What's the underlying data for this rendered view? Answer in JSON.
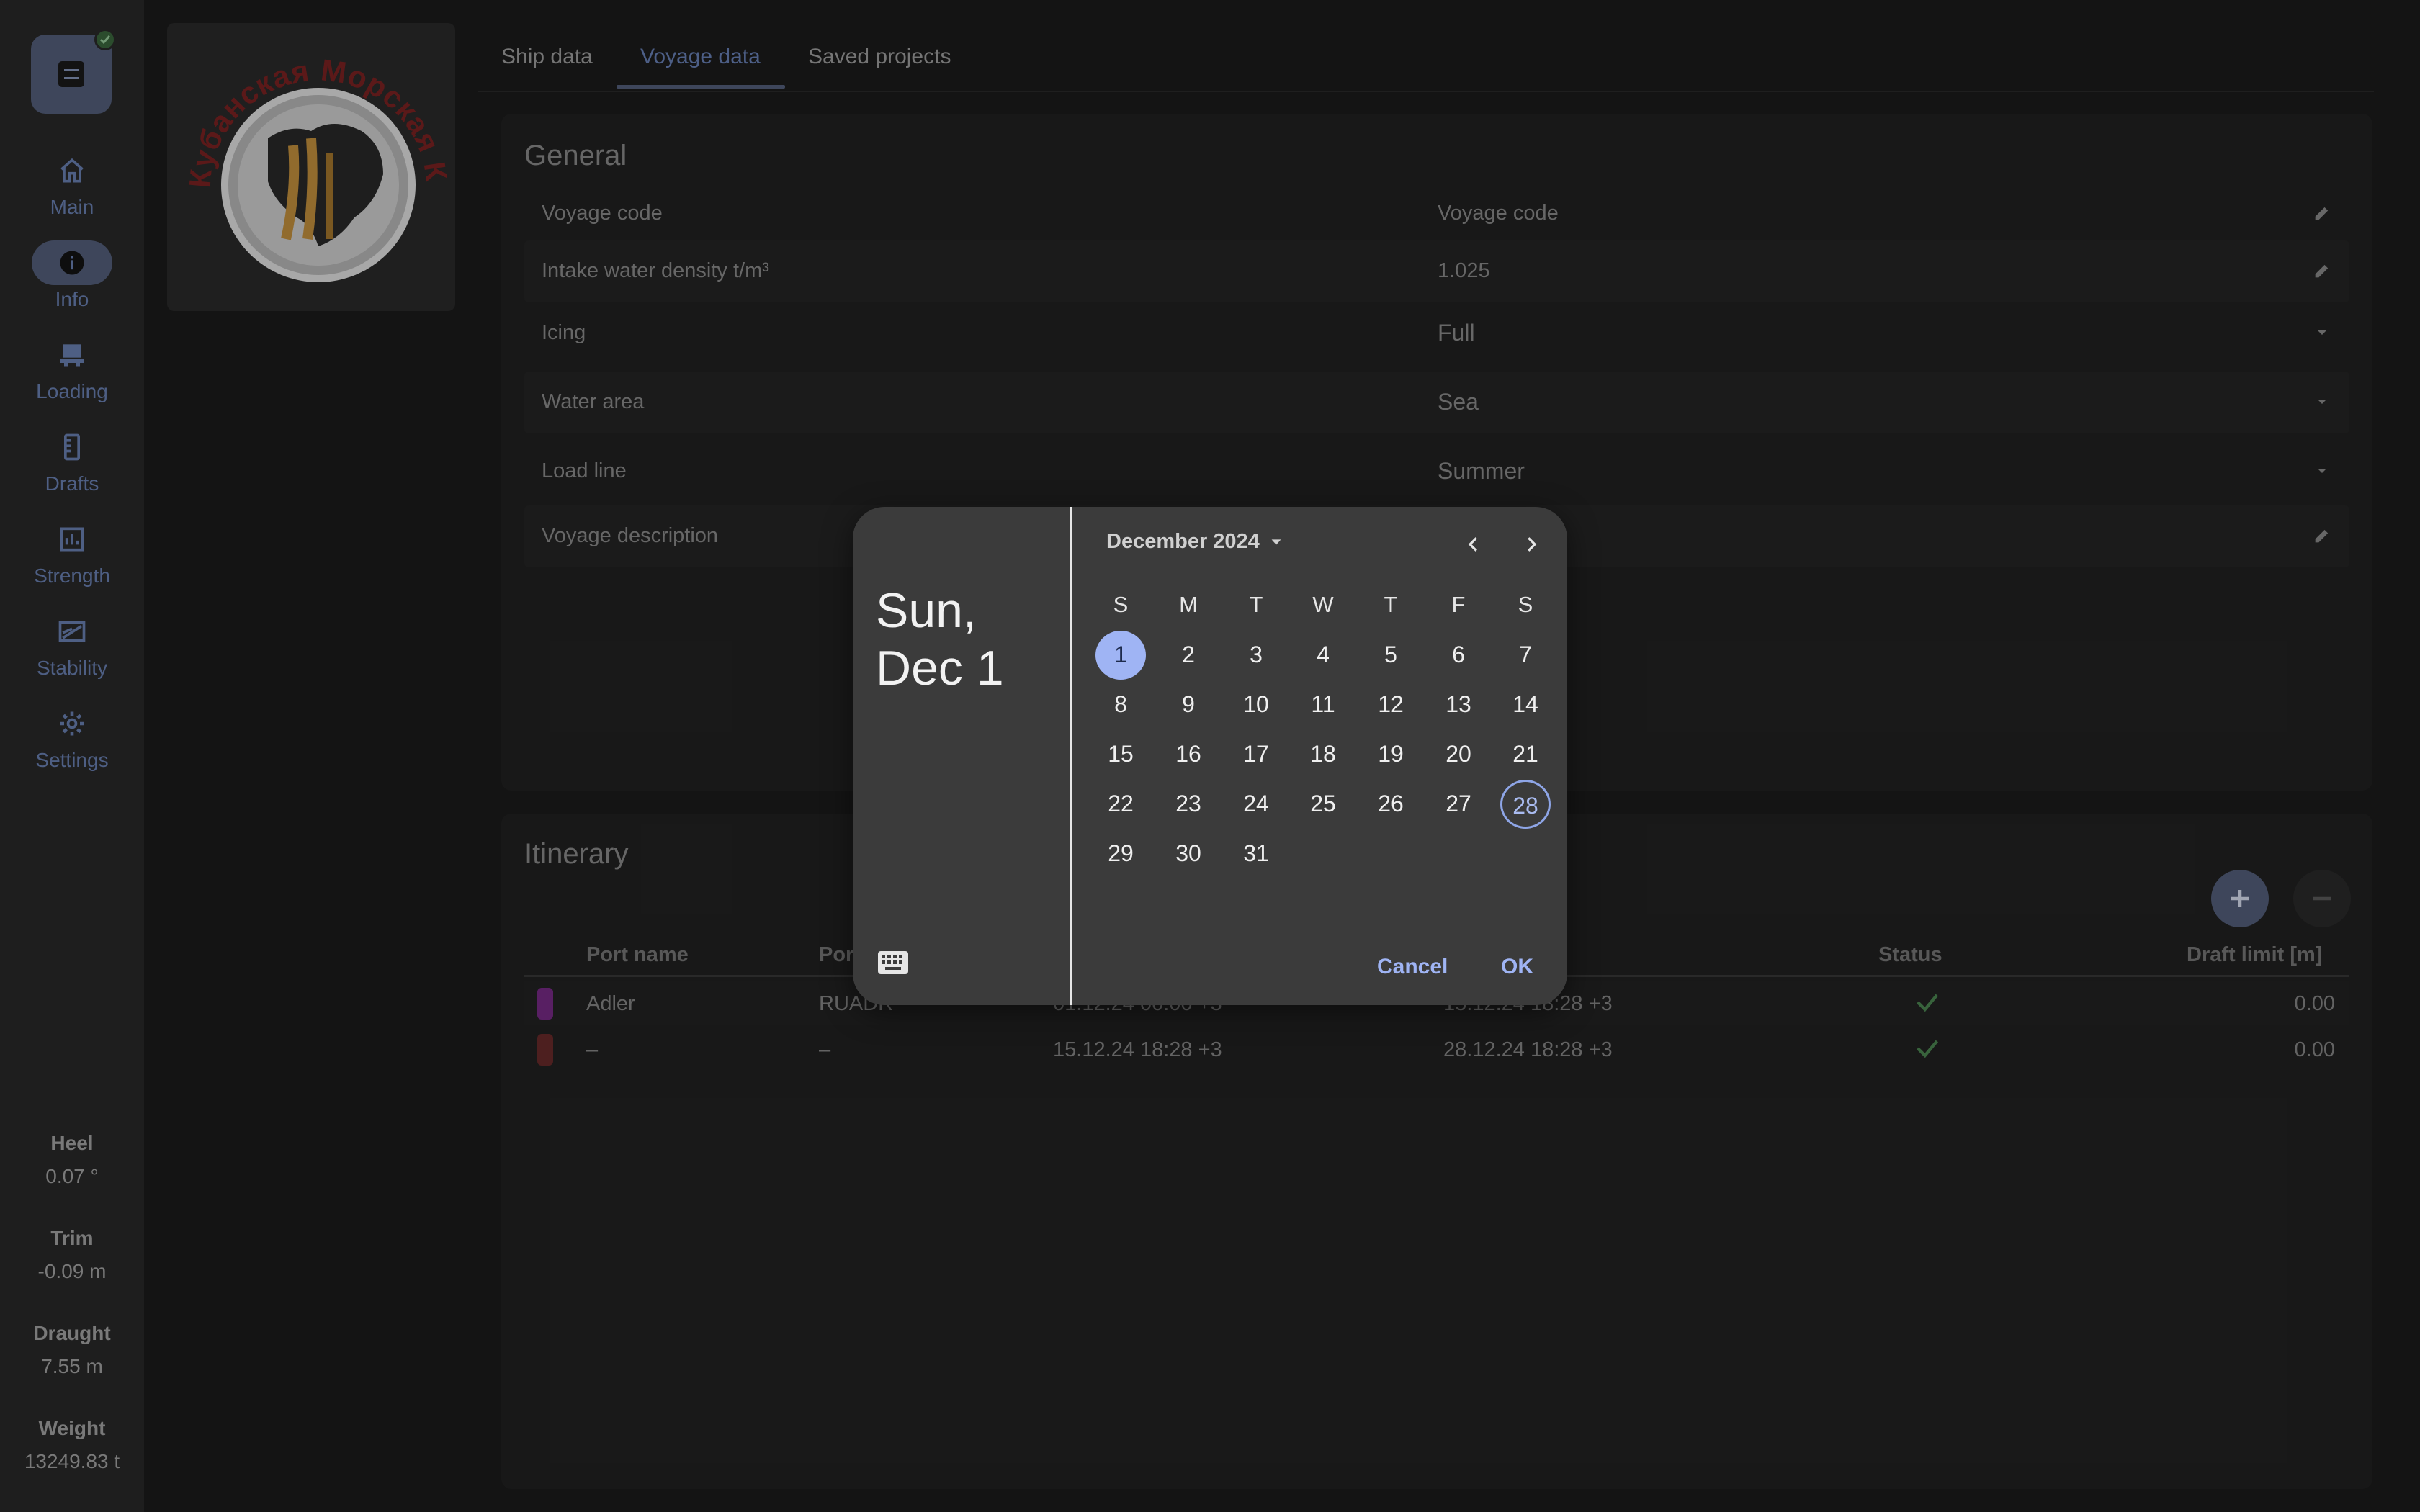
{
  "nav": {
    "items": [
      {
        "label": "Main",
        "icon": "home-icon"
      },
      {
        "label": "Info",
        "icon": "info-icon"
      },
      {
        "label": "Loading",
        "icon": "loading-icon"
      },
      {
        "label": "Drafts",
        "icon": "ruler-icon"
      },
      {
        "label": "Strength",
        "icon": "bar-chart-icon"
      },
      {
        "label": "Stability",
        "icon": "stability-icon"
      },
      {
        "label": "Settings",
        "icon": "gear-icon"
      }
    ],
    "active": "Info"
  },
  "stats": [
    {
      "label": "Heel",
      "value": "0.07 °"
    },
    {
      "label": "Trim",
      "value": "-0.09 m"
    },
    {
      "label": "Draught",
      "value": "7.55 m"
    },
    {
      "label": "Weight",
      "value": "13249.83 t"
    }
  ],
  "logo": {
    "text": "Кубанская Морская Компания"
  },
  "tabs": [
    "Ship data",
    "Voyage data",
    "Saved projects"
  ],
  "active_tab": "Voyage data",
  "general": {
    "title": "General",
    "rows": [
      {
        "name": "Voyage code",
        "value": "Voyage code",
        "control": "edit-icon"
      },
      {
        "name": "Intake water density t/m³",
        "value": "1.025",
        "control": "edit-icon"
      },
      {
        "name": "Icing",
        "value": "Full",
        "control": "dropdown-icon"
      },
      {
        "name": "Water area",
        "value": "Sea",
        "control": "dropdown-icon"
      },
      {
        "name": "Load line",
        "value": "Summer",
        "control": "dropdown-icon"
      },
      {
        "name": "Voyage description",
        "value": "",
        "control": "edit-icon"
      }
    ]
  },
  "itinerary": {
    "title": "Itinerary",
    "columns": [
      "Port name",
      "Por",
      "Status",
      "Draft limit [m]"
    ],
    "rows": [
      {
        "color": "#7a2c8a",
        "port_name": "Adler",
        "port_code": "RUADR",
        "arrival": "01.12.24 00:00 +3",
        "departure": "15.12.24 18:28 +3",
        "status": "check",
        "draft_limit": "0.00"
      },
      {
        "color": "#6b2b2b",
        "port_name": "–",
        "port_code": "–",
        "arrival": "15.12.24 18:28 +3",
        "departure": "28.12.24 18:28 +3",
        "status": "check",
        "draft_limit": "0.00"
      }
    ]
  },
  "date_picker": {
    "headline_line1": "Sun,",
    "headline_line2": "Dec 1",
    "month_label": "December 2024",
    "weekdays": [
      "S",
      "M",
      "T",
      "W",
      "T",
      "F",
      "S"
    ],
    "days": [
      "1",
      "2",
      "3",
      "4",
      "5",
      "6",
      "7",
      "8",
      "9",
      "10",
      "11",
      "12",
      "13",
      "14",
      "15",
      "16",
      "17",
      "18",
      "19",
      "20",
      "21",
      "22",
      "23",
      "24",
      "25",
      "26",
      "27",
      "28",
      "29",
      "30",
      "31"
    ],
    "first_weekday": 0,
    "selected_day": "1",
    "today_day": "28",
    "cancel_label": "Cancel",
    "ok_label": "OK"
  },
  "colors": {
    "accent": "#56627f",
    "accent_text": "#6b84bb",
    "picker_accent": "#9fb4f4",
    "ok_green": "#4e8a54"
  }
}
